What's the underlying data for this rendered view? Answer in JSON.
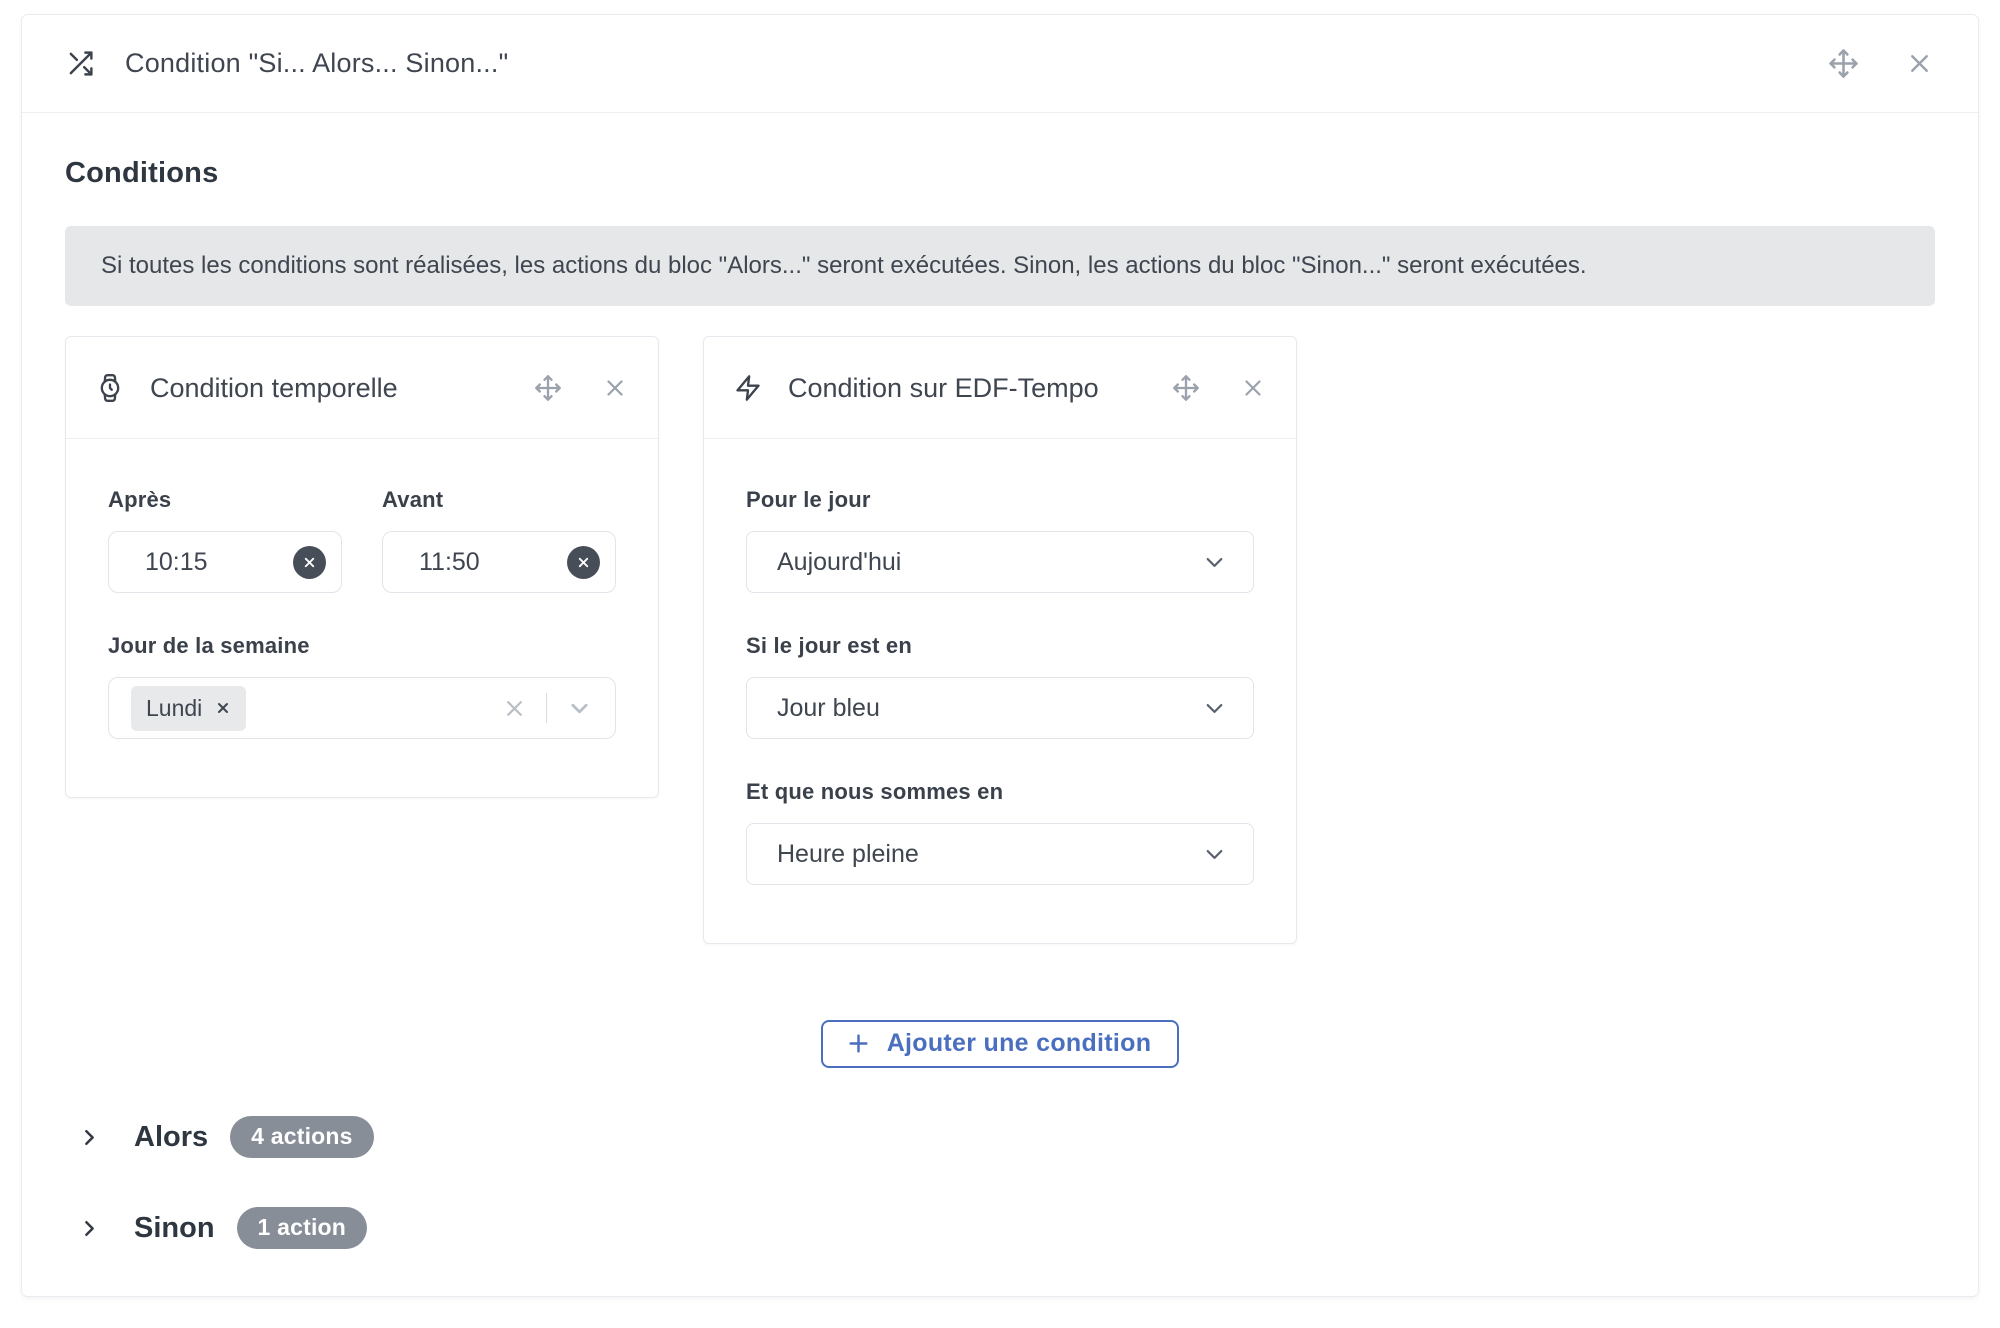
{
  "dialog": {
    "title": "Condition \"Si... Alors... Sinon...\""
  },
  "conditions": {
    "heading": "Conditions",
    "info_text": "Si toutes les conditions sont réalisées, les actions du bloc \"Alors...\" seront exécutées. Sinon, les actions du bloc \"Sinon...\" seront exécutées.",
    "add_button_label": "Ajouter une condition"
  },
  "temporal_card": {
    "title": "Condition temporelle",
    "after": {
      "label": "Après",
      "value": "10:15"
    },
    "before": {
      "label": "Avant",
      "value": "11:50"
    },
    "weekday": {
      "label": "Jour de la semaine",
      "tags": [
        {
          "label": "Lundi"
        }
      ]
    }
  },
  "tempo_card": {
    "title": "Condition sur EDF-Tempo",
    "fields": [
      {
        "label": "Pour le jour",
        "value": "Aujourd'hui"
      },
      {
        "label": "Si le jour est en",
        "value": "Jour bleu"
      },
      {
        "label": "Et que nous sommes en",
        "value": "Heure pleine"
      }
    ]
  },
  "then_block": {
    "label": "Alors",
    "badge": "4 actions"
  },
  "else_block": {
    "label": "Sinon",
    "badge": "1 action"
  },
  "icons": {
    "dialog_left": "shuffle-icon",
    "drag": "move-icon",
    "close": "close-icon",
    "temporal_card": "watch-icon",
    "tempo_card": "zap-icon",
    "select": "chevron-down-icon",
    "collapse": "chevron-right-icon",
    "add": "plus-icon"
  },
  "colors": {
    "accent_blue": "#4a6fbf",
    "badge_gray": "#878e97",
    "clear_button_dark": "#474e58",
    "info_background": "#e5e7e9",
    "dark_text": "#3f4650"
  }
}
